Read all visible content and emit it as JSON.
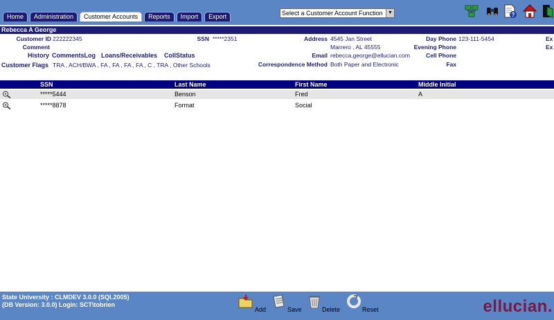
{
  "tabs": [
    {
      "label": "Home"
    },
    {
      "label": "Administration"
    },
    {
      "label": "Customer Accounts"
    },
    {
      "label": "Reports"
    },
    {
      "label": "Import"
    },
    {
      "label": "Export"
    }
  ],
  "toolbar": {
    "function_select": "Select a Customer Account Function",
    "icons": [
      "network-icon",
      "binoculars-icon",
      "help-document-icon",
      "home-icon",
      "exit-icon"
    ]
  },
  "customer": {
    "name": "Rebecca A George",
    "customer_id_label": "Customer ID",
    "customer_id": "222222345",
    "ssn_label": "SSN",
    "ssn": "*****2351",
    "address_label": "Address",
    "address_line1": "4545 Jan Street",
    "address_line2": "Marrero , AL 45555",
    "day_phone_label": "Day Phone",
    "day_phone": "123-111-5454",
    "evening_phone_label": "Evening Phone",
    "cell_phone_label": "Cell Phone",
    "fax_label": "Fax",
    "ext1": "Ex",
    "ext2": "Ex",
    "comment_label": "Comment",
    "history_label": "History",
    "links": [
      "CommentsLog",
      "Loans/Receivables",
      "CollStatus"
    ],
    "email_label": "Email",
    "email": "rebecca.george@ellucian.com",
    "flags_label": "Customer Flags",
    "flags": "TRA , ACH/BWA , FA , FA , FA , FA , C , TRA , Other Schools",
    "correspondence_label": "Correspondence Method",
    "correspondence": "Both Paper and Electronic"
  },
  "table": {
    "columns": [
      "SSN",
      "Last Name",
      "First Name",
      "Middle Initial"
    ],
    "rows": [
      [
        "*****5444",
        "Benson",
        "Fred",
        "A"
      ],
      [
        "*****8878",
        "Format",
        "Social",
        ""
      ]
    ]
  },
  "footer": {
    "line1": "State University : CLMDEV 3.0.0 (SQL2005)",
    "line2": "(DB Version: 3.0.0) Login: SCT\\tobrien",
    "add": "Add",
    "save": "Save",
    "delete": "Delete",
    "reset": "Reset",
    "brand": "ellucian."
  },
  "colors": {
    "header_blue": "#5b86c5",
    "navy": "#1c1c74",
    "brand": "#7a1845"
  }
}
